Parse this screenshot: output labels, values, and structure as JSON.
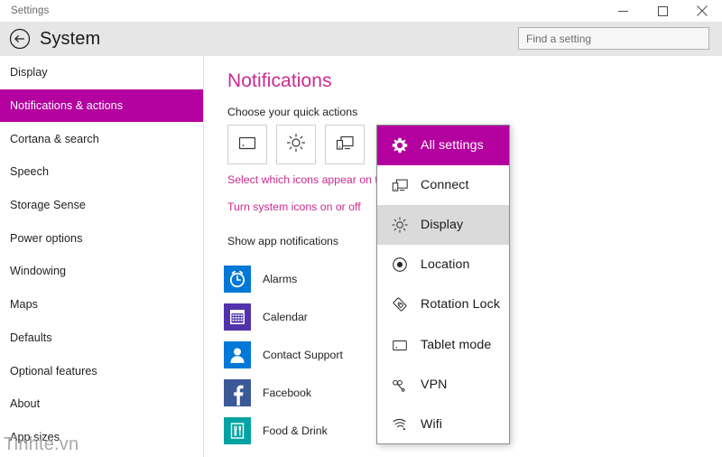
{
  "window": {
    "title": "Settings",
    "controls": [
      {
        "name": "minimize-button",
        "glyph": "minimize"
      },
      {
        "name": "maximize-button",
        "glyph": "maximize"
      },
      {
        "name": "close-button",
        "glyph": "close"
      }
    ]
  },
  "header": {
    "back_icon": "back-arrow-icon",
    "title": "System",
    "search_placeholder": "Find a setting",
    "search_value": ""
  },
  "sidebar": {
    "items": [
      {
        "label": "Display",
        "selected": false
      },
      {
        "label": "Notifications & actions",
        "selected": true
      },
      {
        "label": "Cortana & search",
        "selected": false
      },
      {
        "label": "Speech",
        "selected": false
      },
      {
        "label": "Storage Sense",
        "selected": false
      },
      {
        "label": "Power options",
        "selected": false
      },
      {
        "label": "Windowing",
        "selected": false
      },
      {
        "label": "Maps",
        "selected": false
      },
      {
        "label": "Defaults",
        "selected": false
      },
      {
        "label": "Optional features",
        "selected": false
      },
      {
        "label": "About",
        "selected": false
      },
      {
        "label": "App sizes",
        "selected": false
      }
    ]
  },
  "watermark": "Tinhte.vn",
  "main": {
    "page_title": "Notifications",
    "quick_actions_label": "Choose your quick actions",
    "quick_action_tiles": [
      {
        "icon": "tablet-mode-icon"
      },
      {
        "icon": "brightness-icon"
      },
      {
        "icon": "connect-icon"
      }
    ],
    "links": [
      "Select which icons appear on the taskbar",
      "Turn system icons on or off"
    ],
    "setting_row": {
      "label": "Show app notifications",
      "state": "On"
    },
    "apps": [
      {
        "name": "Alarms",
        "state": "On",
        "icon": "alarm-clock-icon",
        "color": "#0078D7"
      },
      {
        "name": "Calendar",
        "state": "On",
        "icon": "calendar-icon",
        "color": "#5133AB"
      },
      {
        "name": "Contact Support",
        "state": "On",
        "icon": "contact-person-icon",
        "color": "#0078D7"
      },
      {
        "name": "Facebook",
        "state": "On",
        "icon": "facebook-icon",
        "color": "#3B5998"
      },
      {
        "name": "Food & Drink",
        "state": "On",
        "icon": "fork-knife-icon",
        "color": "#00A3A3"
      }
    ]
  },
  "flyout": {
    "items": [
      {
        "label": "All settings",
        "icon": "gear-icon",
        "state": "accent"
      },
      {
        "label": "Connect",
        "icon": "connect-icon",
        "state": "normal"
      },
      {
        "label": "Display",
        "icon": "brightness-icon",
        "state": "hover"
      },
      {
        "label": "Location",
        "icon": "location-icon",
        "state": "normal"
      },
      {
        "label": "Rotation Lock",
        "icon": "rotation-lock-icon",
        "state": "normal"
      },
      {
        "label": "Tablet mode",
        "icon": "tablet-mode-icon",
        "state": "normal"
      },
      {
        "label": "VPN",
        "icon": "vpn-icon",
        "state": "normal"
      },
      {
        "label": "Wifi",
        "icon": "wifi-icon",
        "state": "normal"
      }
    ]
  },
  "colors": {
    "accent_magenta": "#B4009E",
    "link_magenta": "#CC2A8F",
    "header_gray": "#E6E6E6",
    "hover_gray": "#DADADA"
  }
}
